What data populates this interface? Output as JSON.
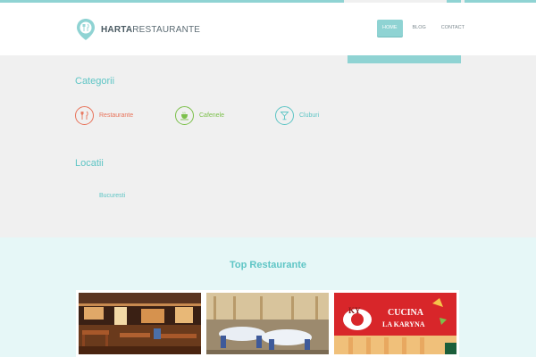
{
  "brand": {
    "bold": "HARTA",
    "light": "RESTAURANTE",
    "accent_color": "#8fd3d3"
  },
  "nav": {
    "items": [
      {
        "label": "HOME",
        "active": true
      },
      {
        "label": "BLOG",
        "active": false
      },
      {
        "label": "CONTACT",
        "active": false
      }
    ]
  },
  "categories": {
    "title": "Categorii",
    "items": [
      {
        "label": "Restaurante",
        "icon": "fork-knife-icon",
        "color": "#e8735a"
      },
      {
        "label": "Cafenele",
        "icon": "coffee-cup-icon",
        "color": "#7cc04b"
      },
      {
        "label": "Cluburi",
        "icon": "cocktail-glass-icon",
        "color": "#5ec5c5"
      }
    ]
  },
  "locations": {
    "title": "Locatii",
    "items": [
      {
        "label": "Bucuresti"
      }
    ]
  },
  "top_restaurants": {
    "title": "Top Restaurante",
    "cards": [
      {
        "image": "restaurant-interior-wood"
      },
      {
        "image": "restaurant-banquet-hall"
      },
      {
        "image": "restaurant-logo-banner",
        "logo_text": "KY",
        "sign_line1": "CUCINA",
        "sign_line2": "LA KARYNA"
      }
    ]
  }
}
